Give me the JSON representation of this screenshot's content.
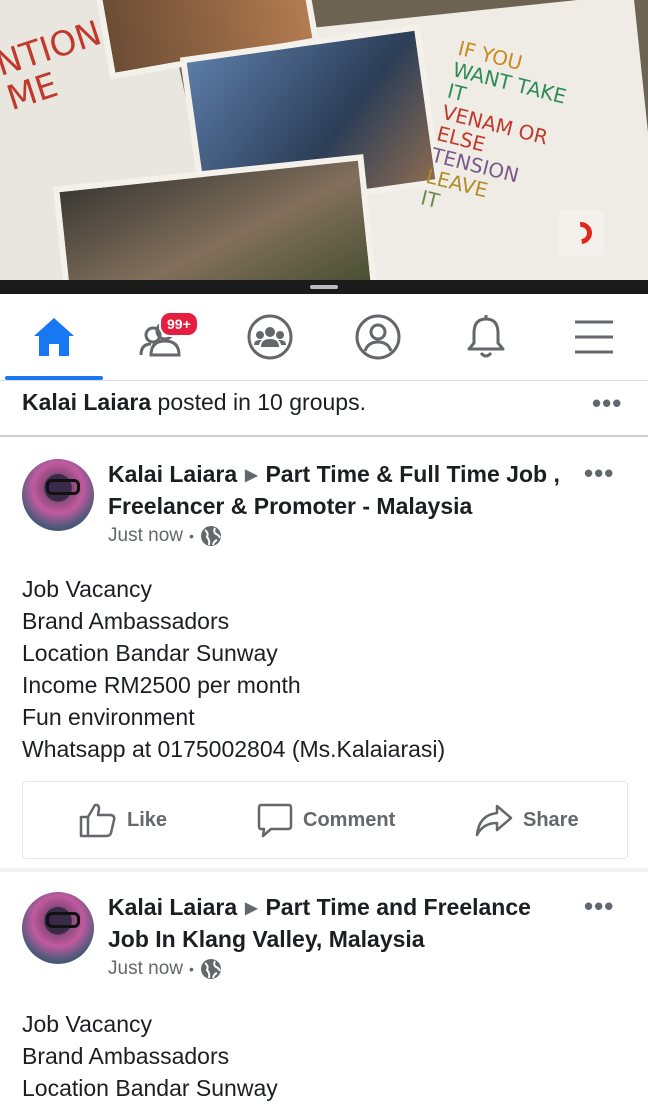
{
  "video": {
    "wall_text_lines": [
      "NTION",
      "ME"
    ],
    "quote_lines": [
      "IF YOU",
      "WANT TAKE IT",
      "VENAM OR ELSE",
      "TENSION",
      "LEAVE",
      "IT"
    ],
    "logo_label": "sony-music-logo"
  },
  "nav": {
    "friends_badge": "99+",
    "tabs": [
      "home",
      "friends",
      "groups",
      "profile",
      "notifications",
      "menu"
    ],
    "active_tab": "home",
    "accent_color": "#1877f2"
  },
  "summary": {
    "author": "Kalai Laiara",
    "text": " posted in 10 groups."
  },
  "posts": [
    {
      "author": "Kalai Laiara",
      "group": "Part Time & Full Time Job , Freelancer & Promoter - Malaysia",
      "time": "Just now",
      "lines": [
        "Job Vacancy",
        "Brand Ambassadors",
        "Location Bandar Sunway",
        "Income RM2500 per month",
        "Fun environment",
        "Whatsapp at 0175002804 (Ms.Kalaiarasi)"
      ],
      "actions": {
        "like": "Like",
        "comment": "Comment",
        "share": "Share"
      }
    },
    {
      "author": "Kalai Laiara",
      "group": "Part Time and Freelance Job In Klang Valley, Malaysia",
      "time": "Just now",
      "lines": [
        "Job Vacancy",
        "Brand Ambassadors",
        "Location Bandar Sunway"
      ]
    }
  ]
}
